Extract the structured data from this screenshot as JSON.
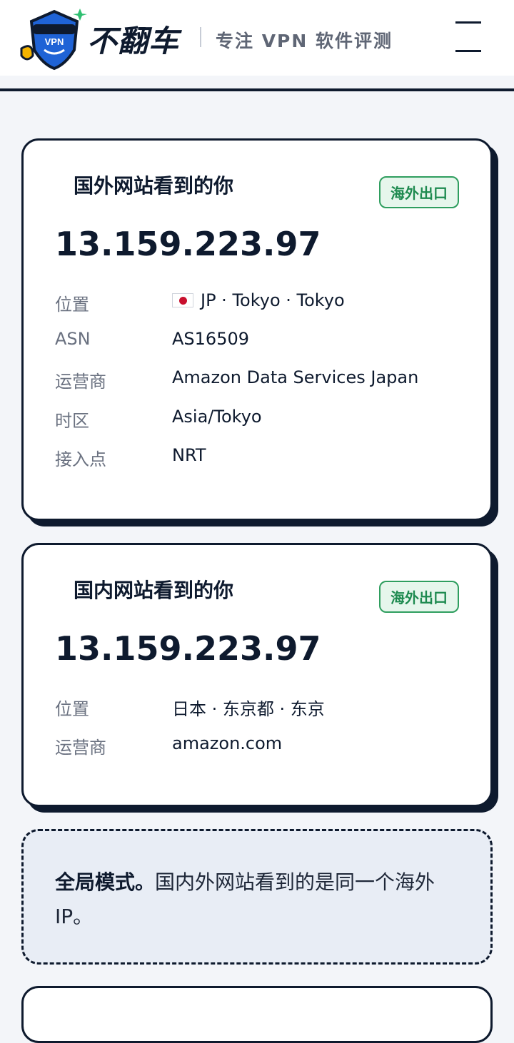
{
  "header": {
    "brand_name": "不翻车",
    "logo_text": "VPN",
    "tagline": "专注 VPN 软件评测"
  },
  "cards": [
    {
      "title": "国外网站看到的你",
      "badge": "海外出口",
      "ip": "13.159.223.97",
      "rows": [
        {
          "label": "位置",
          "value": "JP · Tokyo · Tokyo",
          "flag": "jp-flag-icon"
        },
        {
          "label": "ASN",
          "value": "AS16509"
        },
        {
          "label": "运营商",
          "value": "Amazon Data Services Japan"
        },
        {
          "label": "时区",
          "value": "Asia/Tokyo"
        },
        {
          "label": "接入点",
          "value": "NRT"
        }
      ]
    },
    {
      "title": "国内网站看到的你",
      "badge": "海外出口",
      "ip": "13.159.223.97",
      "rows": [
        {
          "label": "位置",
          "value": "日本 · 东京都 · 东京"
        },
        {
          "label": "运营商",
          "value": "amazon.com"
        }
      ]
    }
  ],
  "note": {
    "bold": "全局模式。",
    "text": "国内外网站看到的是同一个海外 IP。"
  },
  "colors": {
    "ink": "#0e1a2e",
    "badge_green": "#1d8a4f",
    "note_bg": "#e8edf5"
  }
}
